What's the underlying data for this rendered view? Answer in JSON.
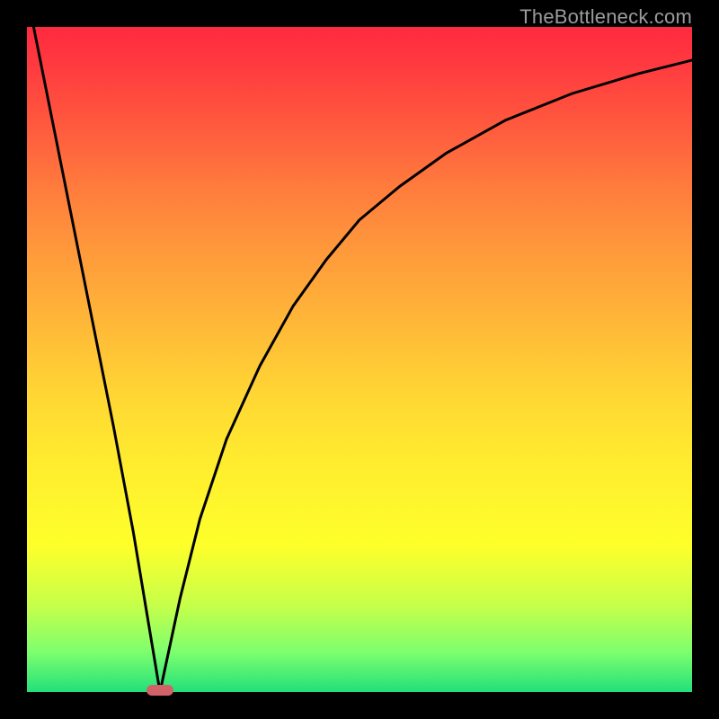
{
  "watermark": {
    "text": "TheBottleneck.com"
  },
  "colors": {
    "frame": "#000000",
    "curve": "#000000",
    "marker": "#d2626a",
    "gradient_top": "#ff2a3f",
    "gradient_mid": "#ffd833",
    "gradient_bottom": "#22e07a"
  },
  "chart_data": {
    "type": "line",
    "title": "",
    "xlabel": "",
    "ylabel": "",
    "xlim": [
      0,
      100
    ],
    "ylim": [
      0,
      100
    ],
    "grid": false,
    "legend": false,
    "notes": "V-shaped bottleneck curve. Left branch descends steeply from top-left to the minimum; right branch rises with diminishing slope toward top-right. Minimum marked by small rounded bar on x-axis.",
    "series": [
      {
        "name": "left_branch",
        "x": [
          1,
          4,
          7,
          10,
          13,
          16,
          18,
          20
        ],
        "y": [
          100,
          85,
          70,
          55,
          40,
          24,
          12,
          0
        ]
      },
      {
        "name": "right_branch",
        "x": [
          20,
          23,
          26,
          30,
          35,
          40,
          45,
          50,
          56,
          63,
          72,
          82,
          92,
          100
        ],
        "y": [
          0,
          14,
          26,
          38,
          49,
          58,
          65,
          71,
          76,
          81,
          86,
          90,
          93,
          95
        ]
      }
    ],
    "minimum_marker": {
      "x_start": 18,
      "x_end": 22,
      "y": 0
    }
  }
}
